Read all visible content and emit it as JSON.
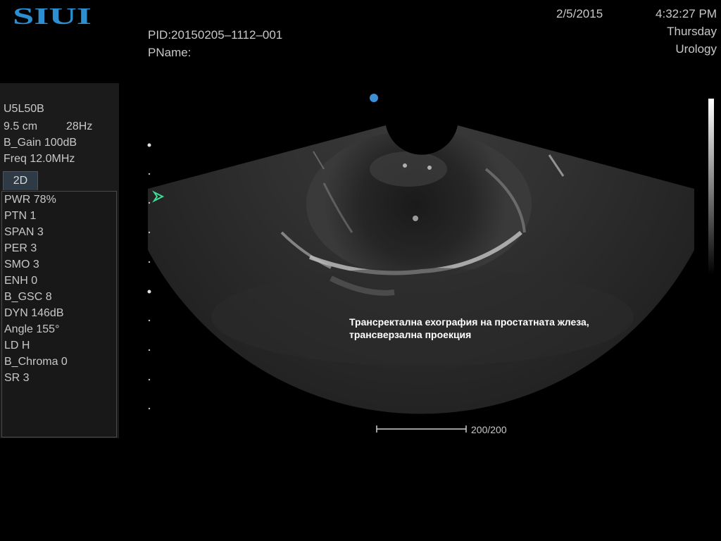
{
  "brand": {
    "logo_text": "SIUI"
  },
  "patient": {
    "pid": "PID:20150205–1112–001",
    "pname": "PName:"
  },
  "datetime": {
    "date": "2/5/2015",
    "time": "4:32:27 PM",
    "day": "Thursday",
    "department": "Urology"
  },
  "probe": {
    "model": "U5L50B",
    "depth": "9.5 cm",
    "frame_rate": "28Hz",
    "gain": "B_Gain 100dB",
    "freq": "Freq 12.0MHz"
  },
  "mode": {
    "tab_label": "2D"
  },
  "params": [
    "PWR 78%",
    "PTN 1",
    "SPAN 3",
    "PER 3",
    "SMO 3",
    "ENH 0",
    "B_GSC 8",
    "DYN 146dB",
    "Angle 155°",
    "LD H",
    "B_Chroma 0",
    "SR 3"
  ],
  "image": {
    "caption_line1": "Трансректална ехография на простатната жлеза,",
    "caption_line2": "трансверзална проекция",
    "scale_label": "200/200"
  },
  "colors": {
    "focus_marker": "#3d8fd6",
    "orientation_marker": "#3ddc97",
    "panel_bg": "#1b1b1b",
    "text": "#c8c8c8"
  }
}
